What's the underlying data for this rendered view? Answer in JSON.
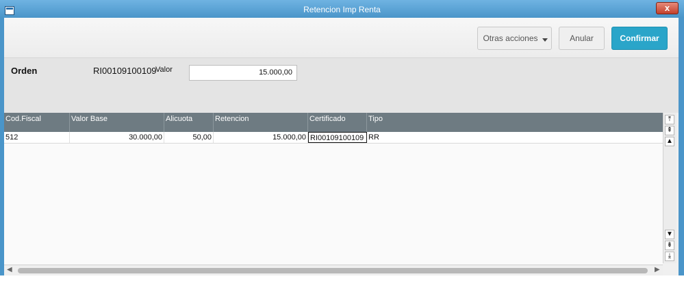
{
  "window": {
    "title": "Retencion Imp Renta",
    "close_label": "x"
  },
  "toolbar": {
    "otras_acciones_label": "Otras acciones",
    "anular_label": "Anular",
    "confirmar_label": "Confirmar"
  },
  "form": {
    "orden_label": "Orden",
    "orden_value": "RI00109100109",
    "valor_label": "Valor",
    "valor_value": "15.000,00"
  },
  "grid": {
    "columns": [
      "Cod.Fiscal",
      "Valor Base",
      "Alicuota",
      "Retencion",
      "Certificado",
      "Tipo"
    ],
    "rows": [
      [
        "512",
        "30.000,00",
        "50,00",
        "15.000,00",
        "RI00109100109",
        "RR"
      ]
    ]
  },
  "scroll": {
    "top_icon": "scroll-top-icon",
    "page_up_icon": "scroll-page-up-icon",
    "up_icon": "scroll-up-icon",
    "down_icon": "scroll-down-icon",
    "page_down_icon": "scroll-page-down-icon",
    "bottom_icon": "scroll-bottom-icon"
  },
  "colors": {
    "accent": "#2aa5c9",
    "titlebar": "#4a95c9",
    "grid_header": "#6e7b82"
  }
}
